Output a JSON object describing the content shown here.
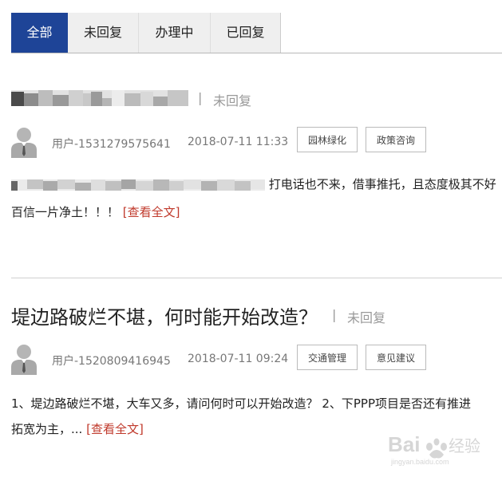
{
  "tabs": [
    "全部",
    "未回复",
    "办理中",
    "已回复"
  ],
  "posts": [
    {
      "title": "",
      "status": "未回复",
      "user": "用户-1531279575641",
      "time": "2018-07-11 11:33",
      "tags": [
        "园林绿化",
        "政策咨询"
      ],
      "body_line1": "打电话也不来，借事推托，且态度极其不好",
      "body_line2": "百信一片净土！！！",
      "more": "[查看全文]"
    },
    {
      "title": "堤边路破烂不堪，何时能开始改造？",
      "status": "未回复",
      "user": "用户-1520809416945",
      "time": "2018-07-11 09:24",
      "tags": [
        "交通管理",
        "意见建议"
      ],
      "body_line1": "1、堤边路破烂不堪，大车又多，请问何时可以开始改造？ 2、下PPP项目是否还有推进",
      "body_line2": "拓宽为主，...",
      "more": "[查看全文]"
    }
  ],
  "watermark": {
    "text": "Bai 经验",
    "sub": "jingyan.baidu.com"
  }
}
